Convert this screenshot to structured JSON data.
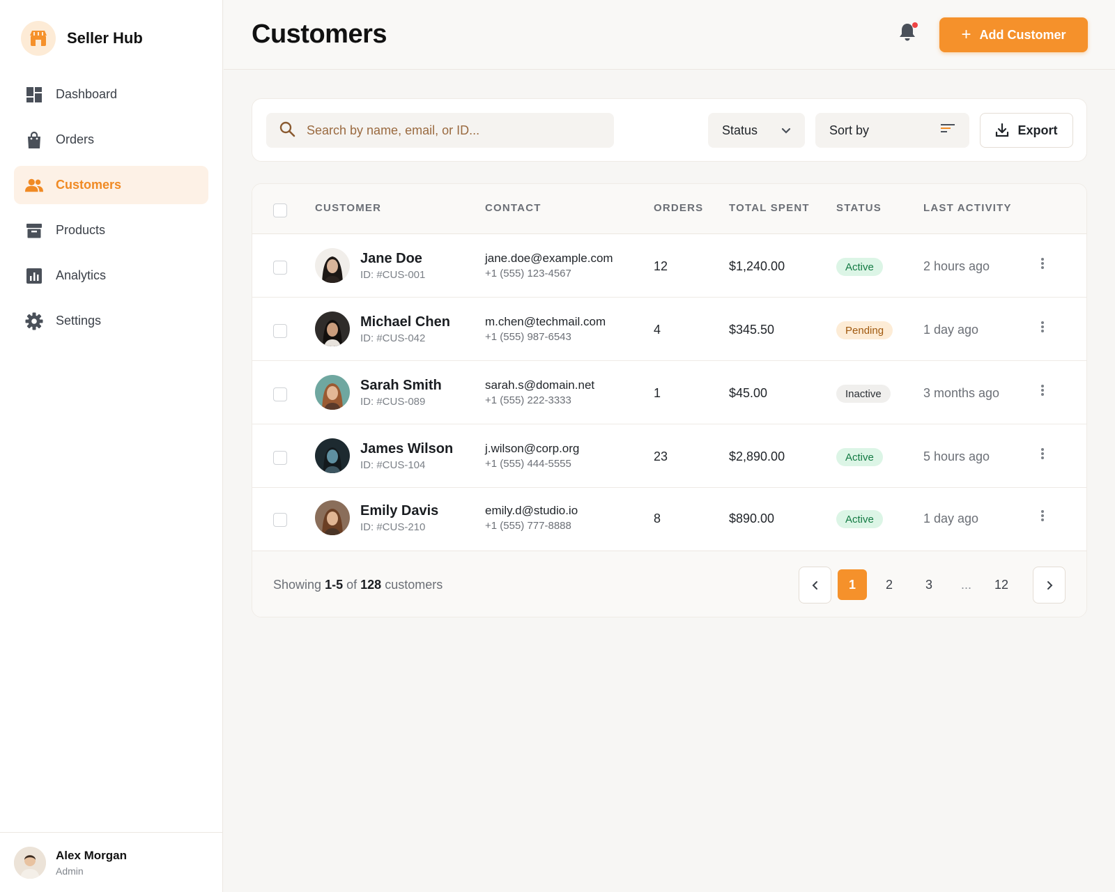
{
  "brand": {
    "name": "Seller Hub"
  },
  "sidebar": {
    "items": [
      {
        "label": "Dashboard",
        "icon": "dashboard-icon",
        "active": false
      },
      {
        "label": "Orders",
        "icon": "shopping-bag-icon",
        "active": false
      },
      {
        "label": "Customers",
        "icon": "users-icon",
        "active": true
      },
      {
        "label": "Products",
        "icon": "archive-box-icon",
        "active": false
      },
      {
        "label": "Analytics",
        "icon": "bar-chart-icon",
        "active": false
      },
      {
        "label": "Settings",
        "icon": "gear-icon",
        "active": false
      }
    ],
    "user": {
      "name": "Alex Morgan",
      "role": "Admin"
    }
  },
  "header": {
    "title": "Customers",
    "add_button_label": "Add Customer",
    "has_notification": true
  },
  "toolbar": {
    "search_placeholder": "Search by name, email, or ID...",
    "status_label": "Status",
    "sort_label": "Sort by",
    "export_label": "Export"
  },
  "table": {
    "columns": [
      "CUSTOMER",
      "CONTACT",
      "ORDERS",
      "TOTAL SPENT",
      "STATUS",
      "LAST ACTIVITY"
    ],
    "rows": [
      {
        "name": "Jane Doe",
        "id": "ID: #CUS-001",
        "email": "jane.doe@example.com",
        "phone": "+1 (555) 123-4567",
        "orders": "12",
        "spent": "$1,240.00",
        "status": "Active",
        "activity": "2 hours ago"
      },
      {
        "name": "Michael Chen",
        "id": "ID: #CUS-042",
        "email": "m.chen@techmail.com",
        "phone": "+1 (555) 987-6543",
        "orders": "4",
        "spent": "$345.50",
        "status": "Pending",
        "activity": "1 day ago"
      },
      {
        "name": "Sarah Smith",
        "id": "ID: #CUS-089",
        "email": "sarah.s@domain.net",
        "phone": "+1 (555) 222-3333",
        "orders": "1",
        "spent": "$45.00",
        "status": "Inactive",
        "activity": "3 months ago"
      },
      {
        "name": "James Wilson",
        "id": "ID: #CUS-104",
        "email": "j.wilson@corp.org",
        "phone": "+1 (555) 444-5555",
        "orders": "23",
        "spent": "$2,890.00",
        "status": "Active",
        "activity": "5 hours ago"
      },
      {
        "name": "Emily Davis",
        "id": "ID: #CUS-210",
        "email": "emily.d@studio.io",
        "phone": "+1 (555) 777-8888",
        "orders": "8",
        "spent": "$890.00",
        "status": "Active",
        "activity": "1 day ago"
      }
    ]
  },
  "footer": {
    "showing_prefix": "Showing",
    "showing_range": "1-5",
    "showing_of": "of",
    "showing_total": "128",
    "showing_suffix": "customers",
    "pages": [
      "1",
      "2",
      "3",
      "12"
    ],
    "ellipsis": "...",
    "current_page": "1"
  },
  "colors": {
    "accent": "#f5912b",
    "active_badge": "#dcf5e6",
    "pending_badge": "#fdecd6",
    "inactive_badge": "#f0efed",
    "notification_dot": "#ef4444"
  }
}
